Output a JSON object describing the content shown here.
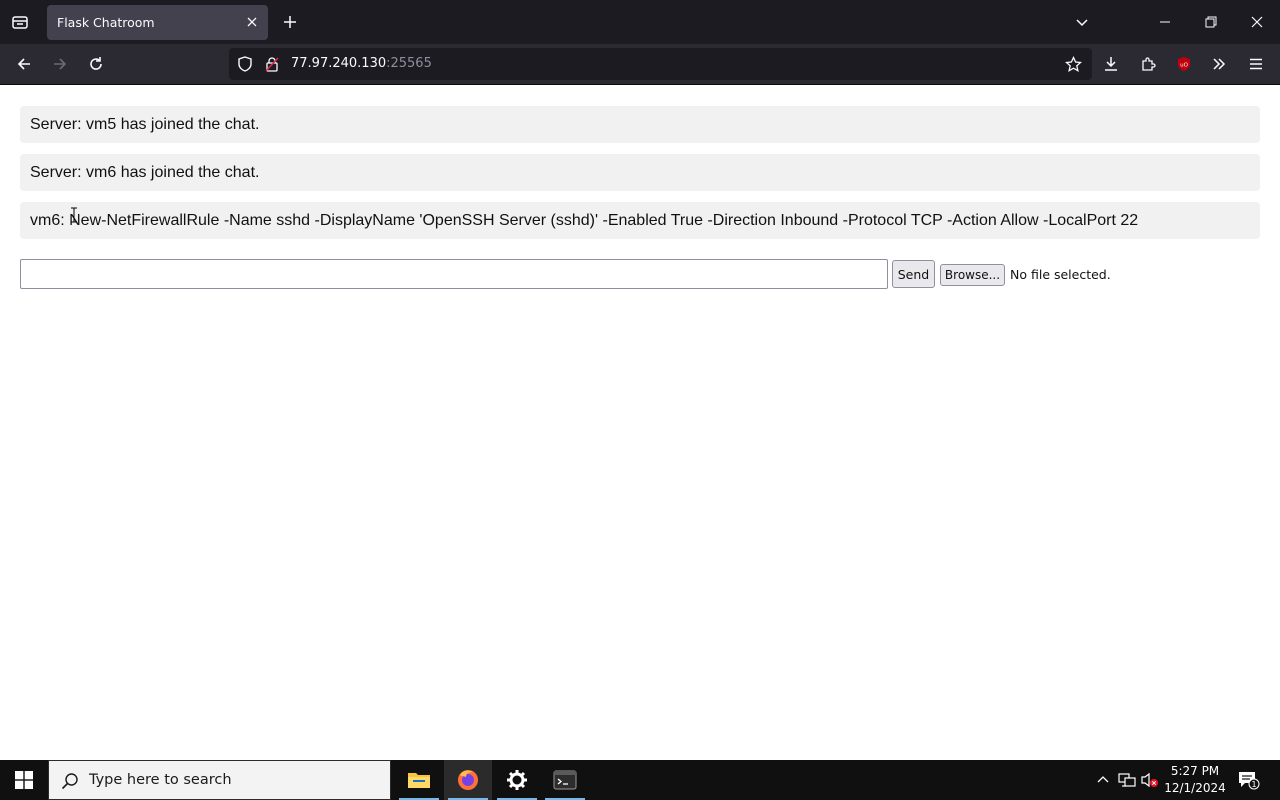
{
  "browser": {
    "tab_title": "Flask Chatroom",
    "url_host": "77.97.240.130",
    "url_port": ":25565"
  },
  "chat": {
    "messages": [
      {
        "text": "Server: vm5 has joined the chat."
      },
      {
        "text": "Server: vm6 has joined the chat."
      },
      {
        "text": "vm6: New-NetFirewallRule -Name sshd -DisplayName 'OpenSSH Server (sshd)' -Enabled True -Direction Inbound -Protocol TCP -Action Allow -LocalPort 22"
      }
    ],
    "input_value": "",
    "send_label": "Send",
    "browse_label": "Browse...",
    "file_status": "No file selected."
  },
  "taskbar": {
    "search_placeholder": "Type here to search",
    "time": "5:27 PM",
    "date": "12/1/2024",
    "notification_count": "1",
    "apps": [
      "file-explorer",
      "firefox",
      "settings",
      "terminal"
    ]
  },
  "colors": {
    "tab_bar": "#1c1b22",
    "nav_bar": "#2b2a33",
    "message_bg": "#f1f1f1",
    "taskbar": "#101010",
    "accent": "#76b9ed"
  }
}
